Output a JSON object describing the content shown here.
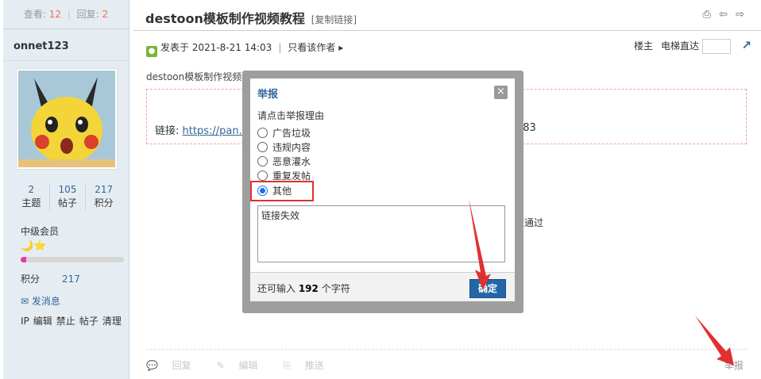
{
  "sidebar": {
    "stats": {
      "views_label": "查看:",
      "views": "12",
      "replies_label": "回复:",
      "replies": "2"
    },
    "username": "onnet123",
    "user_stats": [
      {
        "value": "2",
        "label": "主题"
      },
      {
        "value": "105",
        "label": "帖子"
      },
      {
        "value": "217",
        "label": "积分"
      }
    ],
    "level": "中级会员",
    "level_icons": "🌙⭐",
    "level_progress": 0.05,
    "points_label": "积分",
    "points_value": "217",
    "send_message": "发消息",
    "admin_links": [
      "IP",
      "编辑",
      "禁止",
      "帖子",
      "清理"
    ]
  },
  "thread": {
    "title": "destoon模板制作视频教程",
    "copy_link": "[复制链接]",
    "tool_icons": "⎙ ⇦ ⇨"
  },
  "post": {
    "posted": "发表于 2021-8-21 14:03",
    "only_author": "只看该作者 ▸",
    "floor_label": "楼主",
    "elevator_label": "电梯直达",
    "text": "destoon模板制作视频教",
    "link_label": "链接: ",
    "link_url": "https://pan.b",
    "link_tail": "783",
    "audit_tail": "核通过"
  },
  "actions": {
    "reply": "回复",
    "edit": "编辑",
    "promote": "推送",
    "report": "举报"
  },
  "dialog": {
    "title": "举报",
    "close": "×",
    "prompt": "请点击举报理由",
    "options": [
      {
        "label": "广告垃圾",
        "checked": false
      },
      {
        "label": "违规内容",
        "checked": false
      },
      {
        "label": "恶意灌水",
        "checked": false
      },
      {
        "label": "重复发帖",
        "checked": false
      },
      {
        "label": "其他",
        "checked": true
      }
    ],
    "reason_value": "链接失效",
    "remain_prefix": "还可输入 ",
    "remain_count": "192",
    "remain_suffix": " 个字符",
    "ok_label": "确定"
  },
  "colors": {
    "accent": "#336699",
    "count_highlight": "#f26c4f",
    "annotation": "#e03131",
    "ok_button": "#2366a8"
  }
}
